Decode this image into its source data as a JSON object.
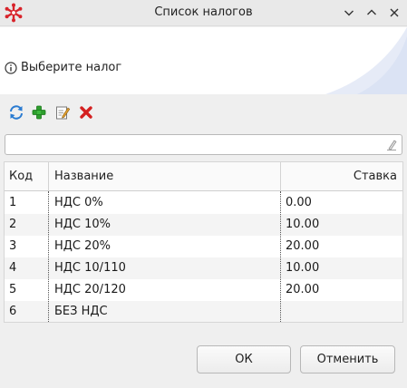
{
  "window": {
    "title": "Список налогов",
    "controls": [
      "chevron-down-icon",
      "chevron-up-icon",
      "close-icon"
    ]
  },
  "banner": {
    "hint": "Выберите налог",
    "icon": "info-icon"
  },
  "toolbar": {
    "buttons": [
      "refresh-icon",
      "add-icon",
      "edit-icon",
      "delete-icon"
    ]
  },
  "filter": {
    "value": "",
    "placeholder": ""
  },
  "table": {
    "columns": [
      "Код",
      "Название",
      "Ставка"
    ],
    "rows": [
      {
        "code": "1",
        "name": "НДС 0%",
        "rate": "0.00"
      },
      {
        "code": "2",
        "name": "НДС 10%",
        "rate": "10.00"
      },
      {
        "code": "3",
        "name": "НДС 20%",
        "rate": "20.00"
      },
      {
        "code": "4",
        "name": "НДС 10/110",
        "rate": "10.00"
      },
      {
        "code": "5",
        "name": "НДС 20/120",
        "rate": "20.00"
      },
      {
        "code": "6",
        "name": "БЕЗ НДС",
        "rate": ""
      }
    ]
  },
  "buttons": {
    "ok": "ОК",
    "cancel": "Отменить"
  },
  "colors": {
    "accent": "#d8232a",
    "add": "#2e9e2e",
    "refresh": "#2a7bd1"
  }
}
